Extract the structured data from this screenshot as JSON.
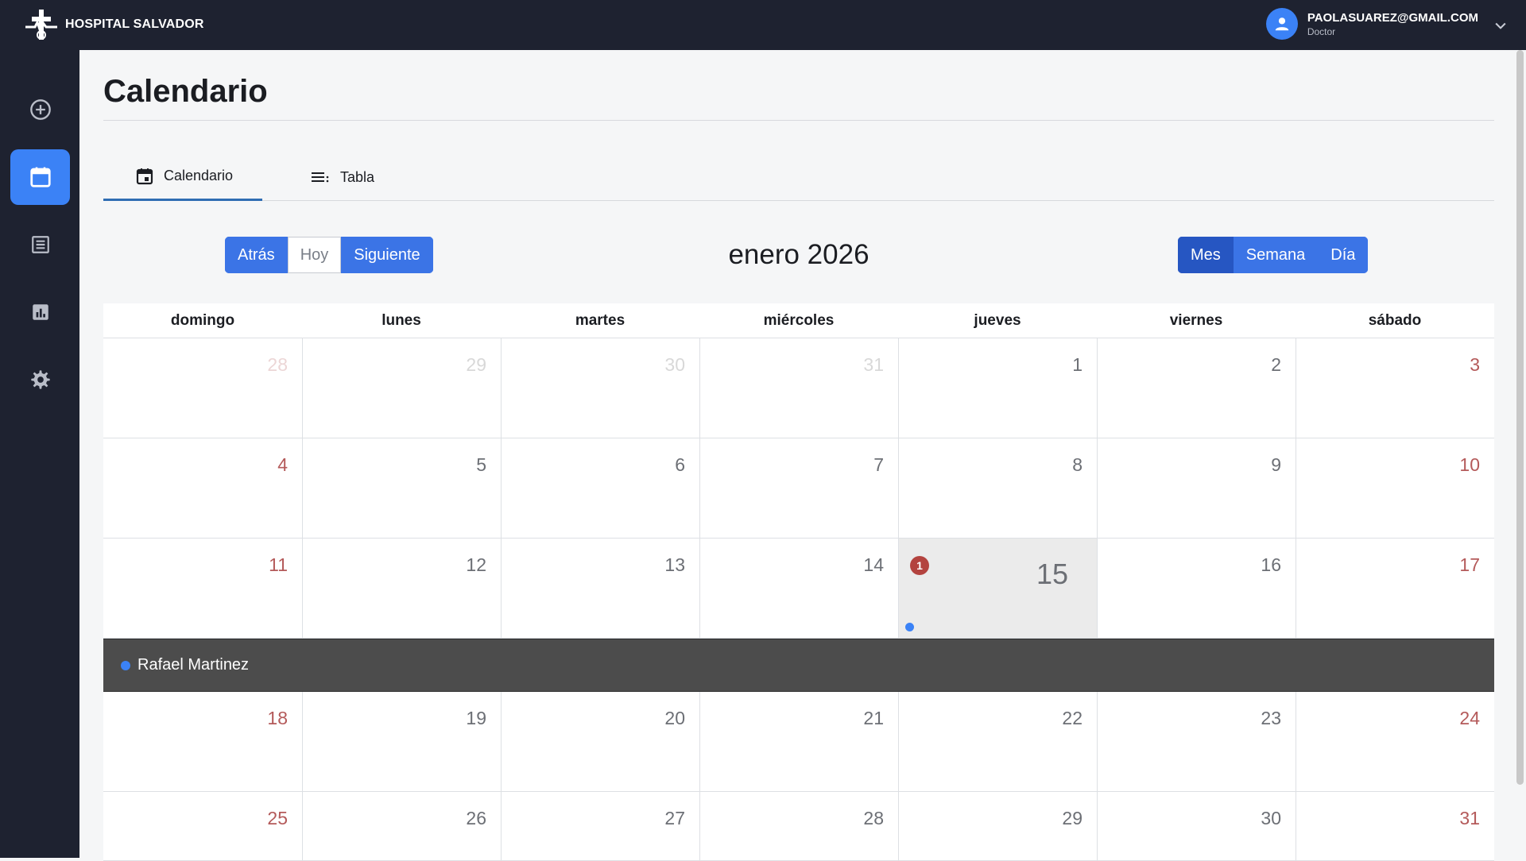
{
  "app": {
    "brand_name": "HOSPITAL SALVADOR"
  },
  "user": {
    "email": "PAOLASUAREZ@GMAIL.COM",
    "role": "Doctor"
  },
  "sidebar": {
    "items": [
      {
        "icon": "add-circle-icon",
        "active": false
      },
      {
        "icon": "calendar-icon",
        "active": true
      },
      {
        "icon": "list-icon",
        "active": false
      },
      {
        "icon": "chart-icon",
        "active": false
      },
      {
        "icon": "gear-icon",
        "active": false
      }
    ]
  },
  "page": {
    "title": "Calendario"
  },
  "tabs": [
    {
      "label": "Calendario",
      "icon": "calendar-icon",
      "active": true
    },
    {
      "label": "Tabla",
      "icon": "list-icon",
      "active": false
    }
  ],
  "toolbar": {
    "back": "Atrás",
    "today": "Hoy",
    "next": "Siguiente",
    "month_label": "enero 2026",
    "view_month": "Mes",
    "view_week": "Semana",
    "view_day": "Día"
  },
  "calendar": {
    "weekdays": [
      "domingo",
      "lunes",
      "martes",
      "miércoles",
      "jueves",
      "viernes",
      "sábado"
    ],
    "weeks": [
      [
        "28",
        "29",
        "30",
        "31",
        "1",
        "2",
        "3"
      ],
      [
        "4",
        "5",
        "6",
        "7",
        "8",
        "9",
        "10"
      ],
      [
        "11",
        "12",
        "13",
        "14",
        "15",
        "16",
        "17"
      ],
      [
        "18",
        "19",
        "20",
        "21",
        "22",
        "23",
        "24"
      ],
      [
        "25",
        "26",
        "27",
        "28",
        "29",
        "30",
        "31"
      ]
    ],
    "today_badge": "1",
    "event_name": "Rafael Martinez"
  },
  "colors": {
    "accent": "#3b74e6",
    "accent_dark": "#2656c2",
    "header_bg": "#1e2230",
    "weekend_text": "#b45a5a",
    "badge": "#b3433f",
    "event_band": "#4c4c4c"
  }
}
